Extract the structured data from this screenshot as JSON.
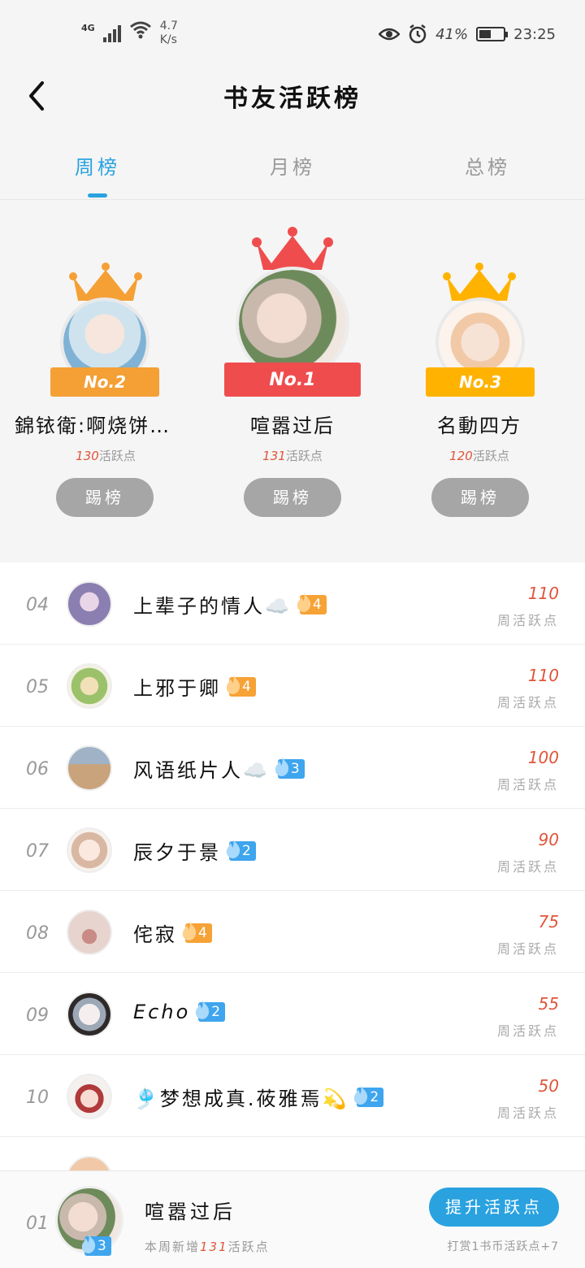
{
  "status_bar": {
    "signal": "4G",
    "net_speed_value": "4.7",
    "net_speed_unit": "K/s",
    "battery": "41%",
    "time": "23:25"
  },
  "header": {
    "title": "书友活跃榜"
  },
  "tabs": [
    {
      "label": "周榜"
    },
    {
      "label": "月榜"
    },
    {
      "label": "总榜"
    }
  ],
  "podium": [
    {
      "badge": "No.2",
      "name": "錦铱衛:啊烧饼…",
      "points": "130",
      "unit": "活跃点",
      "button": "踢榜"
    },
    {
      "badge": "No.1",
      "name": "喧嚣过后",
      "points": "131",
      "unit": "活跃点",
      "button": "踢榜"
    },
    {
      "badge": "No.3",
      "name": "名動四方",
      "points": "120",
      "unit": "活跃点",
      "button": "踢榜"
    }
  ],
  "list": [
    {
      "rank": "04",
      "name": "上辈子的情人☁️",
      "level": "4",
      "level_color": "#f6a236",
      "points": "110",
      "unit": "周活跃点"
    },
    {
      "rank": "05",
      "name": "上邪于卿",
      "level": "4",
      "level_color": "#f6a236",
      "points": "110",
      "unit": "周活跃点"
    },
    {
      "rank": "06",
      "name": "风语纸片人☁️",
      "level": "3",
      "level_color": "#3ea5ee",
      "points": "100",
      "unit": "周活跃点"
    },
    {
      "rank": "07",
      "name": "辰夕于景",
      "level": "2",
      "level_color": "#3ea5ee",
      "points": "90",
      "unit": "周活跃点"
    },
    {
      "rank": "08",
      "name": "侘寂",
      "level": "4",
      "level_color": "#f6a236",
      "points": "75",
      "unit": "周活跃点"
    },
    {
      "rank": "09",
      "name": "Echo",
      "level": "2",
      "level_color": "#3ea5ee",
      "points": "55",
      "unit": "周活跃点"
    },
    {
      "rank": "10",
      "name": "🎐梦想成真.莜雅焉💫",
      "level": "2",
      "level_color": "#3ea5ee",
      "points": "50",
      "unit": "周活跃点"
    }
  ],
  "my_rank": {
    "rank": "01",
    "name": "喧嚣过后",
    "level": "3",
    "sub_prefix": "本周新增",
    "sub_points": "131",
    "sub_suffix": "活跃点",
    "button": "提升活跃点",
    "tip": "打赏1书币活跃点+7"
  },
  "colors": {
    "accent": "#2aa2e0",
    "points": "#e0553a",
    "gold": "#ffb300",
    "red": "#ef4d4d",
    "orange": "#f6a236"
  }
}
